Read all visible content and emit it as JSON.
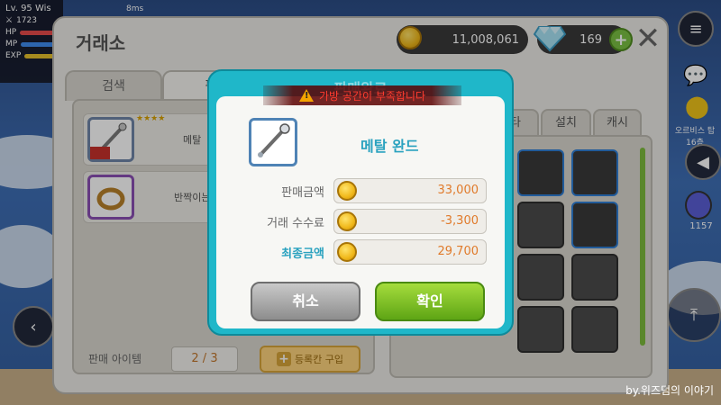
{
  "hud": {
    "level": "Lv. 95",
    "name": "Wis",
    "power": "1723",
    "hp_label": "HP",
    "mp_label": "MP",
    "exp_label": "EXP",
    "ping": "8ms"
  },
  "exchange": {
    "title": "거래소",
    "meso": "11,008,061",
    "crystal": "169",
    "tabs": [
      "검색",
      "판"
    ],
    "inventory_tabs": [
      "타",
      "설치",
      "캐시"
    ],
    "list_items": [
      {
        "name": "메탈",
        "stars": "★★★★"
      },
      {
        "name": "반짝이는",
        "stars": ""
      }
    ],
    "sell_count_label": "판매 아이템",
    "sell_count": "2 / 3",
    "register_button": "등록칸 구입"
  },
  "dialog": {
    "title": "판매완료",
    "warning": "가방 공간이 부족합니다",
    "item_name": "메탈 완드",
    "rows": [
      {
        "label": "판매금액",
        "value": "33,000"
      },
      {
        "label": "거래 수수료",
        "value": "-3,300"
      },
      {
        "label": "최종금액",
        "value": "29,700"
      }
    ],
    "cancel": "취소",
    "confirm": "확인"
  },
  "side": {
    "location": "오르비스 탑 16층",
    "potion_count": "1157"
  },
  "watermark": "by.위즈덤의 이야기",
  "colors": {
    "accent": "#1fb7c9",
    "value_orange": "#e07a2a",
    "warning_red": "#ff3b2f",
    "confirm_green": "#5ea515"
  }
}
